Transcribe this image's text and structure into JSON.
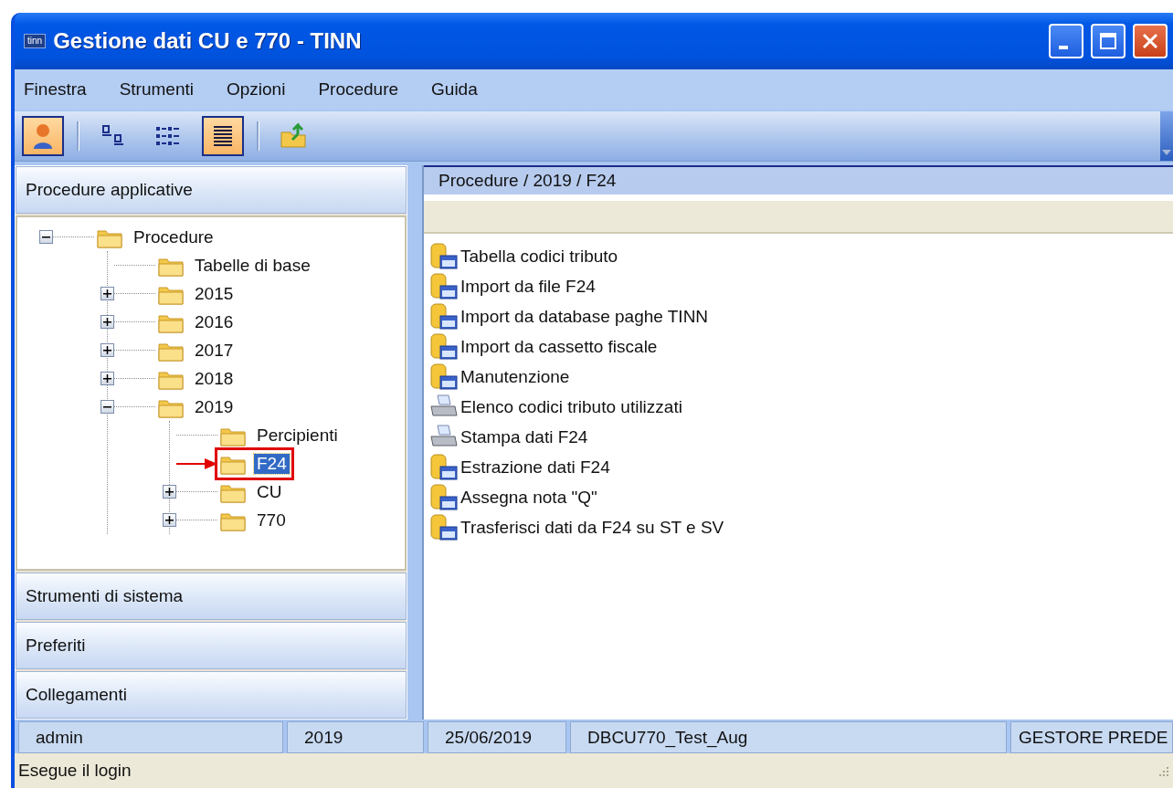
{
  "window": {
    "title": "Gestione dati CU e 770 - TINN",
    "app_badge": "tinn"
  },
  "menu": [
    "Finestra",
    "Strumenti",
    "Opzioni",
    "Procedure",
    "Guida"
  ],
  "toolbar": [
    {
      "kind": "button",
      "pressed": true
    },
    {
      "kind": "separator"
    },
    {
      "kind": "button",
      "pressed": false
    },
    {
      "kind": "button",
      "pressed": false
    },
    {
      "kind": "button",
      "pressed": true
    },
    {
      "kind": "separator"
    },
    {
      "kind": "button",
      "pressed": false
    }
  ],
  "sidebar": {
    "sections": [
      {
        "title": "Procedure applicative",
        "tree": [
          {
            "label": "Procedure",
            "expanded": true,
            "selected": false,
            "children": [
              {
                "label": "Tabelle di base",
                "selected": false
              },
              {
                "label": "2015",
                "expanded": false,
                "selected": false
              },
              {
                "label": "2016",
                "expanded": false,
                "selected": false
              },
              {
                "label": "2017",
                "expanded": false,
                "selected": false
              },
              {
                "label": "2018",
                "expanded": false,
                "selected": false
              },
              {
                "label": "2019",
                "expanded": true,
                "selected": false,
                "children": [
                  {
                    "label": "Percipienti",
                    "selected": false
                  },
                  {
                    "label": "F24",
                    "selected": true,
                    "highlighted": true
                  },
                  {
                    "label": "CU",
                    "expanded": false,
                    "selected": false
                  },
                  {
                    "label": "770",
                    "expanded": false,
                    "selected": false
                  }
                ]
              }
            ]
          }
        ]
      },
      {
        "title": "Strumenti di sistema"
      },
      {
        "title": "Preferiti"
      },
      {
        "title": "Collegamenti"
      }
    ]
  },
  "content": {
    "path": "Procedure / 2019 / F24",
    "items": [
      {
        "label": "Tabella codici tributo",
        "kind": "database"
      },
      {
        "label": "Import da file F24",
        "kind": "database"
      },
      {
        "label": "Import da database paghe TINN",
        "kind": "database"
      },
      {
        "label": "Import da cassetto fiscale",
        "kind": "database"
      },
      {
        "label": "Manutenzione",
        "kind": "database"
      },
      {
        "label": "Elenco codici tributo utilizzati",
        "kind": "printer"
      },
      {
        "label": "Stampa dati F24",
        "kind": "printer"
      },
      {
        "label": "Estrazione dati F24",
        "kind": "database"
      },
      {
        "label": "Assegna nota \"Q\"",
        "kind": "database"
      },
      {
        "label": "Trasferisci dati da F24 su ST e SV",
        "kind": "database"
      }
    ]
  },
  "status_panes": [
    "admin",
    "2019",
    "25/06/2019",
    "DBCU770_Test_Aug",
    "GESTORE PREDE"
  ],
  "status_bar": "Esegue il login"
}
